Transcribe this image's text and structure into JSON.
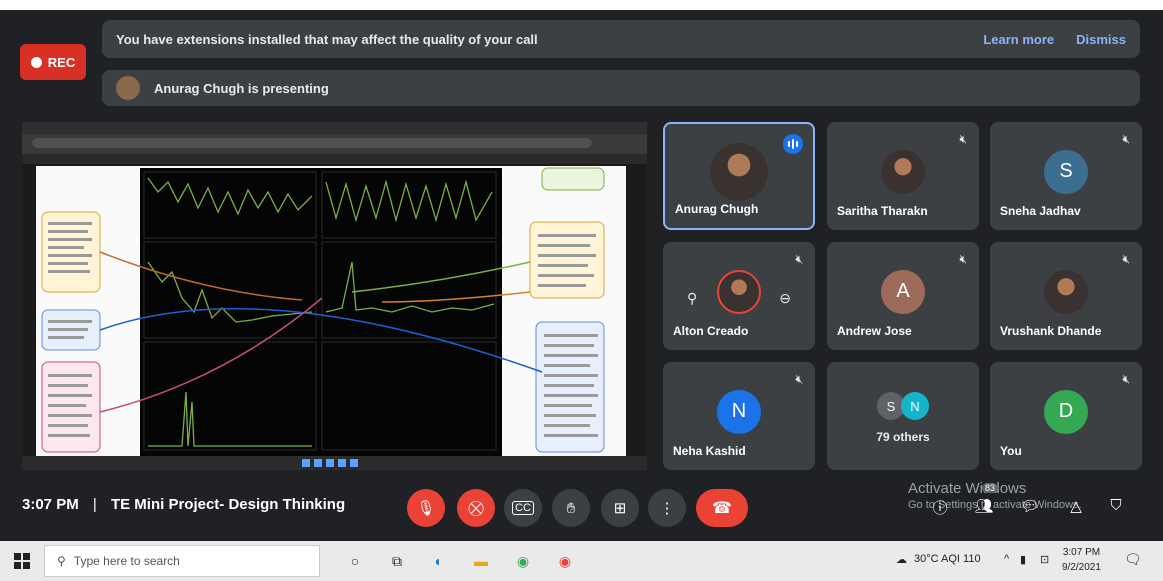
{
  "rec": {
    "label": "REC"
  },
  "banner": {
    "message": "You have extensions installed that may affect the quality of your call",
    "learn_more": "Learn more",
    "dismiss": "Dismiss"
  },
  "presenting": {
    "text": "Anurag Chugh is presenting"
  },
  "participants": [
    {
      "name": "Anurag Chugh",
      "state": "speaking"
    },
    {
      "name": "Saritha Tharakn",
      "state": "muted"
    },
    {
      "name": "Sneha Jadhav",
      "initial": "S",
      "color": "#3c6e8f",
      "state": "muted"
    },
    {
      "name": "Alton Creado",
      "state": "muted"
    },
    {
      "name": "Andrew Jose",
      "initial": "A",
      "color": "#9c6b5a",
      "state": "muted"
    },
    {
      "name": "Vrushank Dhande",
      "state": "muted"
    },
    {
      "name": "Neha Kashid",
      "initial": "N",
      "color": "#1a73e8",
      "state": "muted"
    },
    {
      "name": "79 others",
      "avatars": [
        "S",
        "N"
      ],
      "avatar_colors": [
        "#5f6368",
        "#12b5cb"
      ]
    },
    {
      "name": "You",
      "initial": "D",
      "color": "#34a853",
      "state": "muted"
    }
  ],
  "meeting": {
    "time": "3:07 PM",
    "separator": "|",
    "title": "TE Mini Project- Design Thinking"
  },
  "controls": [
    {
      "name": "microphone",
      "icon": "mic-off-icon",
      "state": "off"
    },
    {
      "name": "camera",
      "icon": "camera-off-icon",
      "state": "off"
    },
    {
      "name": "captions",
      "icon": "captions-icon",
      "label": "CC"
    },
    {
      "name": "raise-hand",
      "icon": "hand-icon"
    },
    {
      "name": "present",
      "icon": "present-icon"
    },
    {
      "name": "more-options",
      "icon": "more-vert-icon"
    },
    {
      "name": "leave-call",
      "icon": "end-call-icon"
    }
  ],
  "windows_watermark": {
    "line1": "Activate Windows",
    "line2": "Go to Settings to activate Windows."
  },
  "right_controls": [
    "info-icon",
    "people-icon",
    "chat-icon",
    "activities-icon",
    "host-controls-icon"
  ],
  "people_badge": "83",
  "taskbar": {
    "search_placeholder": "Type here to search",
    "weather": "30°C AQI 110",
    "time": "3:07 PM",
    "date": "9/2/2021",
    "apps": [
      "cortana-icon",
      "task-view-icon",
      "edge-icon",
      "file-explorer-icon",
      "chrome-icon",
      "chrome-alt-icon"
    ]
  },
  "colors": {
    "background": "#202124",
    "tile": "#3c4043",
    "accent_blue": "#8ab4f8",
    "red": "#ea4335",
    "rec_red": "#d93025"
  }
}
